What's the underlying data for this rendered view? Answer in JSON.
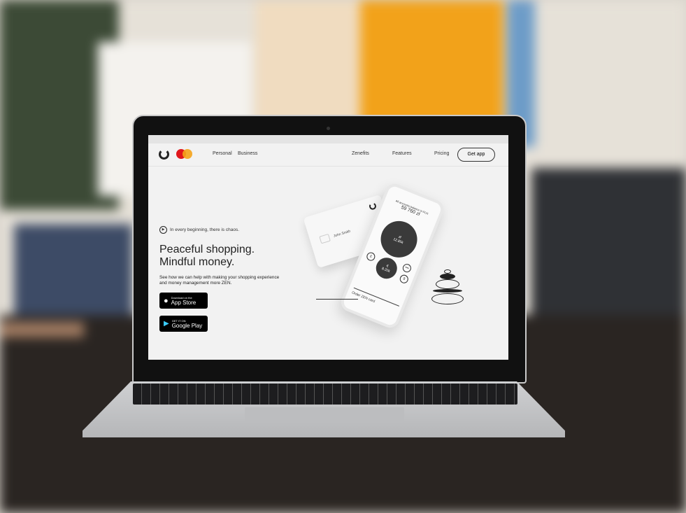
{
  "nav": {
    "personal": "Personal",
    "business": "Business",
    "zenefits": "Zenefits",
    "features": "Features",
    "pricing": "Pricing",
    "get_app": "Get app"
  },
  "hero": {
    "tagline": "In every beginning, there is chaos.",
    "title_line1": "Peaceful shopping.",
    "title_line2": "Mindful money.",
    "subtitle": "See how we can help with making your shopping experience and money management more ZEN."
  },
  "stores": {
    "apple_small": "Download on the",
    "apple_big": "App Store",
    "google_small": "GET IT ON",
    "google_big": "Google Play"
  },
  "card": {
    "name": "John Smith"
  },
  "phone": {
    "balance_label": "All accounts balance in PLN",
    "balance": "59 760 zł",
    "pln_symbol": "zł",
    "pln_amount": "12.85k",
    "eur_symbol": "€",
    "eur_amount": "8.20k",
    "gbp": "£",
    "usd": "$",
    "more": "•••",
    "order": "Order ZEN card"
  }
}
